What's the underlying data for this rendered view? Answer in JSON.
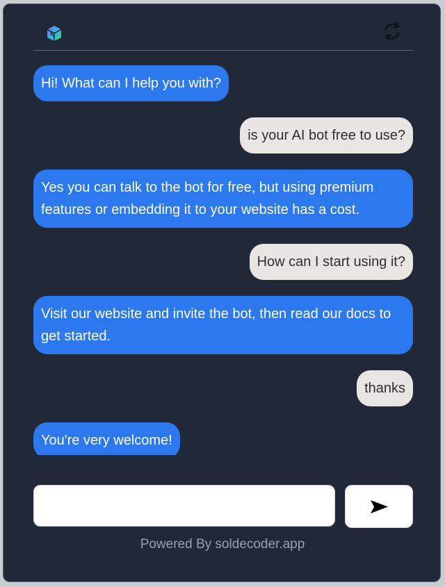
{
  "header": {
    "logo_icon": "cube-logo-icon",
    "refresh_icon": "refresh-icon"
  },
  "messages": [
    {
      "role": "bot",
      "text": "Hi! What can I help you with?"
    },
    {
      "role": "user",
      "text": "is your AI bot free to use?"
    },
    {
      "role": "bot",
      "text": "Yes you can talk to the bot for free, but using premium features or embedding it to your website has a cost."
    },
    {
      "role": "user",
      "text": "How can I start using it?"
    },
    {
      "role": "bot",
      "text": "Visit our website and invite the bot, then read our docs to get started."
    },
    {
      "role": "user",
      "text": "thanks"
    },
    {
      "role": "bot",
      "text": "You're very welcome!"
    }
  ],
  "composer": {
    "value": "",
    "placeholder": "",
    "send_icon": "send-icon"
  },
  "footer": {
    "text": "Powered By soldecoder.app"
  },
  "colors": {
    "background": "#212838",
    "bot_bubble": "#2c78ef",
    "user_bubble": "#e9e5e3"
  }
}
